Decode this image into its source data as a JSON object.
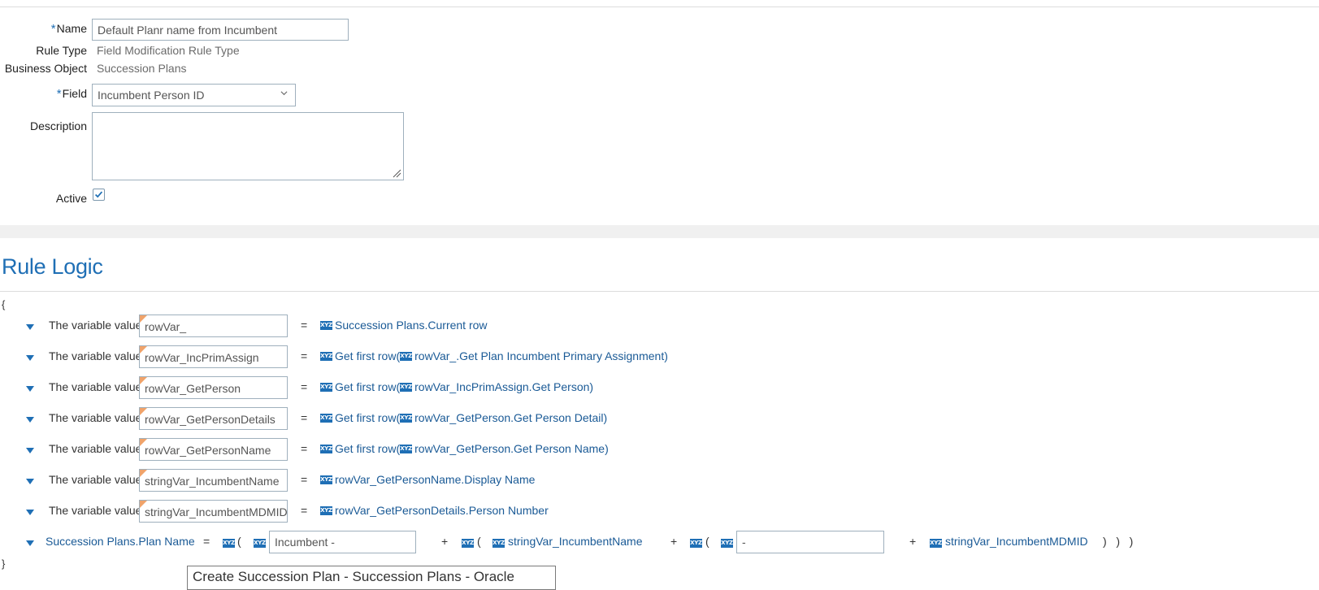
{
  "form": {
    "name_label": "Name",
    "name_value": "Default Planr name from Incumbent",
    "rule_type_label": "Rule Type",
    "rule_type_value": "Field Modification Rule Type",
    "business_object_label": "Business Object",
    "business_object_value": "Succession Plans",
    "field_label": "Field",
    "field_value": "Incumbent Person ID",
    "description_label": "Description",
    "description_value": "",
    "active_label": "Active",
    "active_checked": true,
    "required_marker": "*"
  },
  "rule_logic": {
    "title": "Rule Logic",
    "open_brace": "{",
    "close_brace": "}",
    "row_label": "The variable value",
    "equals": "=",
    "rows": [
      {
        "variable": "rowVar_",
        "expr_parts": [
          "Succession Plans.Current row"
        ]
      },
      {
        "variable": "rowVar_IncPrimAssign",
        "expr_prefix": "Get first row(",
        "expr_inner": "rowVar_.Get Plan Incumbent Primary Assignment",
        "expr_suffix": ")"
      },
      {
        "variable": "rowVar_GetPerson",
        "expr_prefix": "Get first row(",
        "expr_inner": "rowVar_IncPrimAssign.Get Person",
        "expr_suffix": ")"
      },
      {
        "variable": "rowVar_GetPersonDetails",
        "expr_prefix": "Get first row(",
        "expr_inner": "rowVar_GetPerson.Get Person Detail",
        "expr_suffix": ")"
      },
      {
        "variable": "rowVar_GetPersonName",
        "expr_prefix": "Get first row(",
        "expr_inner": "rowVar_GetPerson.Get Person Name",
        "expr_suffix": ")"
      },
      {
        "variable": "stringVar_IncumbentName",
        "expr_parts": [
          "rowVar_GetPersonName.Display Name"
        ]
      },
      {
        "variable": "stringVar_IncumbentMDMID",
        "expr_parts": [
          "rowVar_GetPersonDetails.Person Number"
        ]
      }
    ],
    "last": {
      "target": "Succession Plans.Plan Name",
      "equals": "=",
      "open_paren": "(",
      "literal_1": "Incumbent -",
      "plus": "+",
      "var_1": "stringVar_IncumbentName",
      "literal_2": "-",
      "var_2": "stringVar_IncumbentMDMID",
      "close_parens": ")   )   )"
    },
    "icon_text": "XYZ"
  },
  "tooltip": {
    "text": "Create Succession Plan - Succession Plans - Oracle"
  },
  "colors": {
    "accent": "#1f6fb5",
    "link": "#1a5a96",
    "corner_marker": "#f0a36a"
  }
}
